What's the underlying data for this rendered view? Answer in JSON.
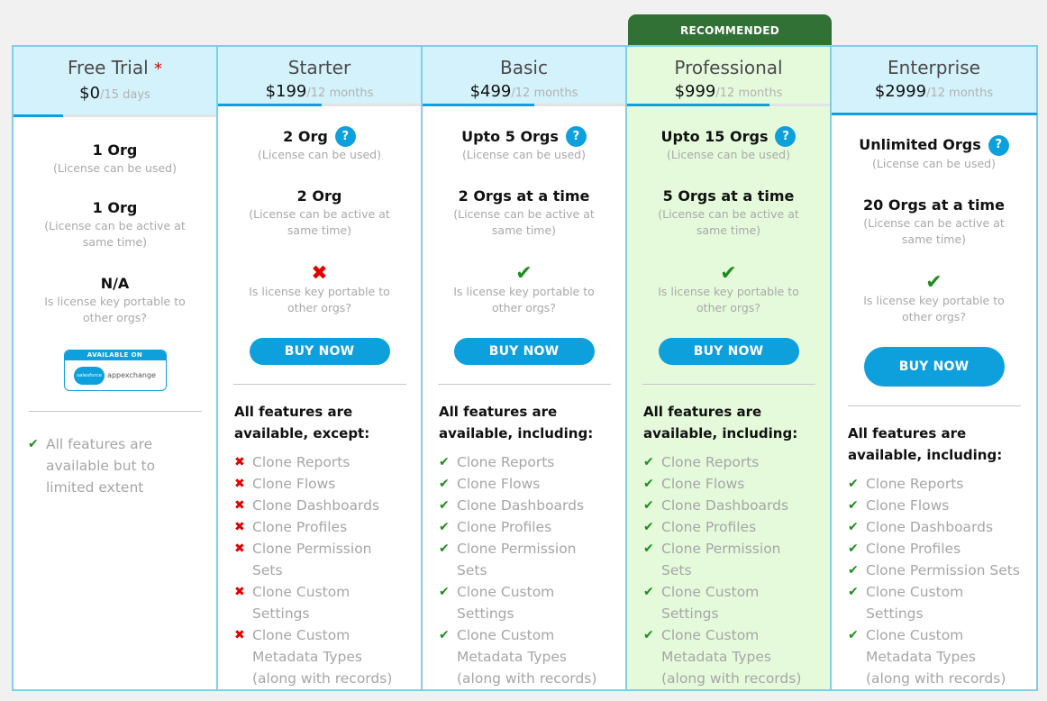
{
  "badge": {
    "recommended": "RECOMMENDED"
  },
  "buy_label": "BUY NOW",
  "colors": {
    "accent": "#0ea0dc",
    "header_bg": "#d3f2fb",
    "recommended_bg": "#e4fadb",
    "badge_bg": "#317135",
    "check": "#1e8c1e",
    "cross": "#e30000"
  },
  "plans": [
    {
      "name": "Free Trial",
      "asterisk": "*",
      "price": "$0",
      "period": "/15 days",
      "orgs_used": "1 Org",
      "orgs_used_sub": "(License can be used)",
      "orgs_active": "1 Org",
      "orgs_active_sub": "(License can be active at same time)",
      "portable": "N/A",
      "portable_sub": "Is license key portable to other orgs?",
      "appexchange": {
        "top": "AVAILABLE ON",
        "cloud": "salesforce",
        "text": "appexchange"
      },
      "note": "All features are available but to limited extent"
    },
    {
      "name": "Starter",
      "price": "$199",
      "period": "/12 months",
      "orgs_used": "2 Org",
      "orgs_used_sub": "(License can be used)",
      "orgs_active": "2 Org",
      "orgs_active_sub": "(License can be active at same time)",
      "portable_icon": "cross-icon",
      "portable_glyph": "✖",
      "portable_sub": "Is license key portable to other orgs?",
      "features_title": "All features are available, except:",
      "features": [
        "Clone Reports",
        "Clone Flows",
        "Clone Dashboards",
        "Clone Profiles",
        "Clone Permission Sets",
        "Clone Custom Settings",
        "Clone Custom Metadata Types (along with records)"
      ]
    },
    {
      "name": "Basic",
      "price": "$499",
      "period": "/12 months",
      "orgs_used": "Upto 5 Orgs",
      "orgs_used_sub": "(License can be used)",
      "orgs_active": "2 Orgs at a time",
      "orgs_active_sub": "(License can be active at same time)",
      "portable_icon": "check-icon",
      "portable_glyph": "✔",
      "portable_sub": "Is license key portable to other orgs?",
      "features_title": "All features are available, including:",
      "features": [
        "Clone Reports",
        "Clone Flows",
        "Clone Dashboards",
        "Clone Profiles",
        "Clone Permission Sets",
        "Clone Custom Settings",
        "Clone Custom Metadata Types (along with records)"
      ]
    },
    {
      "name": "Professional",
      "price": "$999",
      "period": "/12 months",
      "orgs_used": "Upto 15 Orgs",
      "orgs_used_sub": "(License can be used)",
      "orgs_active": "5 Orgs at a time",
      "orgs_active_sub": "(License can be active at same time)",
      "portable_icon": "check-icon",
      "portable_glyph": "✔",
      "portable_sub": "Is license key portable to other orgs?",
      "features_title": "All features are available, including:",
      "features": [
        "Clone Reports",
        "Clone Flows",
        "Clone Dashboards",
        "Clone Profiles",
        "Clone Permission Sets",
        "Clone Custom Settings",
        "Clone Custom Metadata Types (along with records)"
      ]
    },
    {
      "name": "Enterprise",
      "price": "$2999",
      "period": "/12 months",
      "orgs_used": "Unlimited Orgs",
      "orgs_used_sub": "(License can be used)",
      "orgs_active": "20 Orgs at a time",
      "orgs_active_sub": "(License can be active at same time)",
      "portable_icon": "check-icon",
      "portable_glyph": "✔",
      "portable_sub": "Is license key portable to other orgs?",
      "features_title": "All features are available, including:",
      "features": [
        "Clone Reports",
        "Clone Flows",
        "Clone Dashboards",
        "Clone Profiles",
        "Clone Permission Sets",
        "Clone Custom Settings",
        "Clone Custom Metadata Types (along with records)"
      ]
    }
  ],
  "help_glyph": "?",
  "check_glyph": "✔",
  "cross_glyph": "✖"
}
